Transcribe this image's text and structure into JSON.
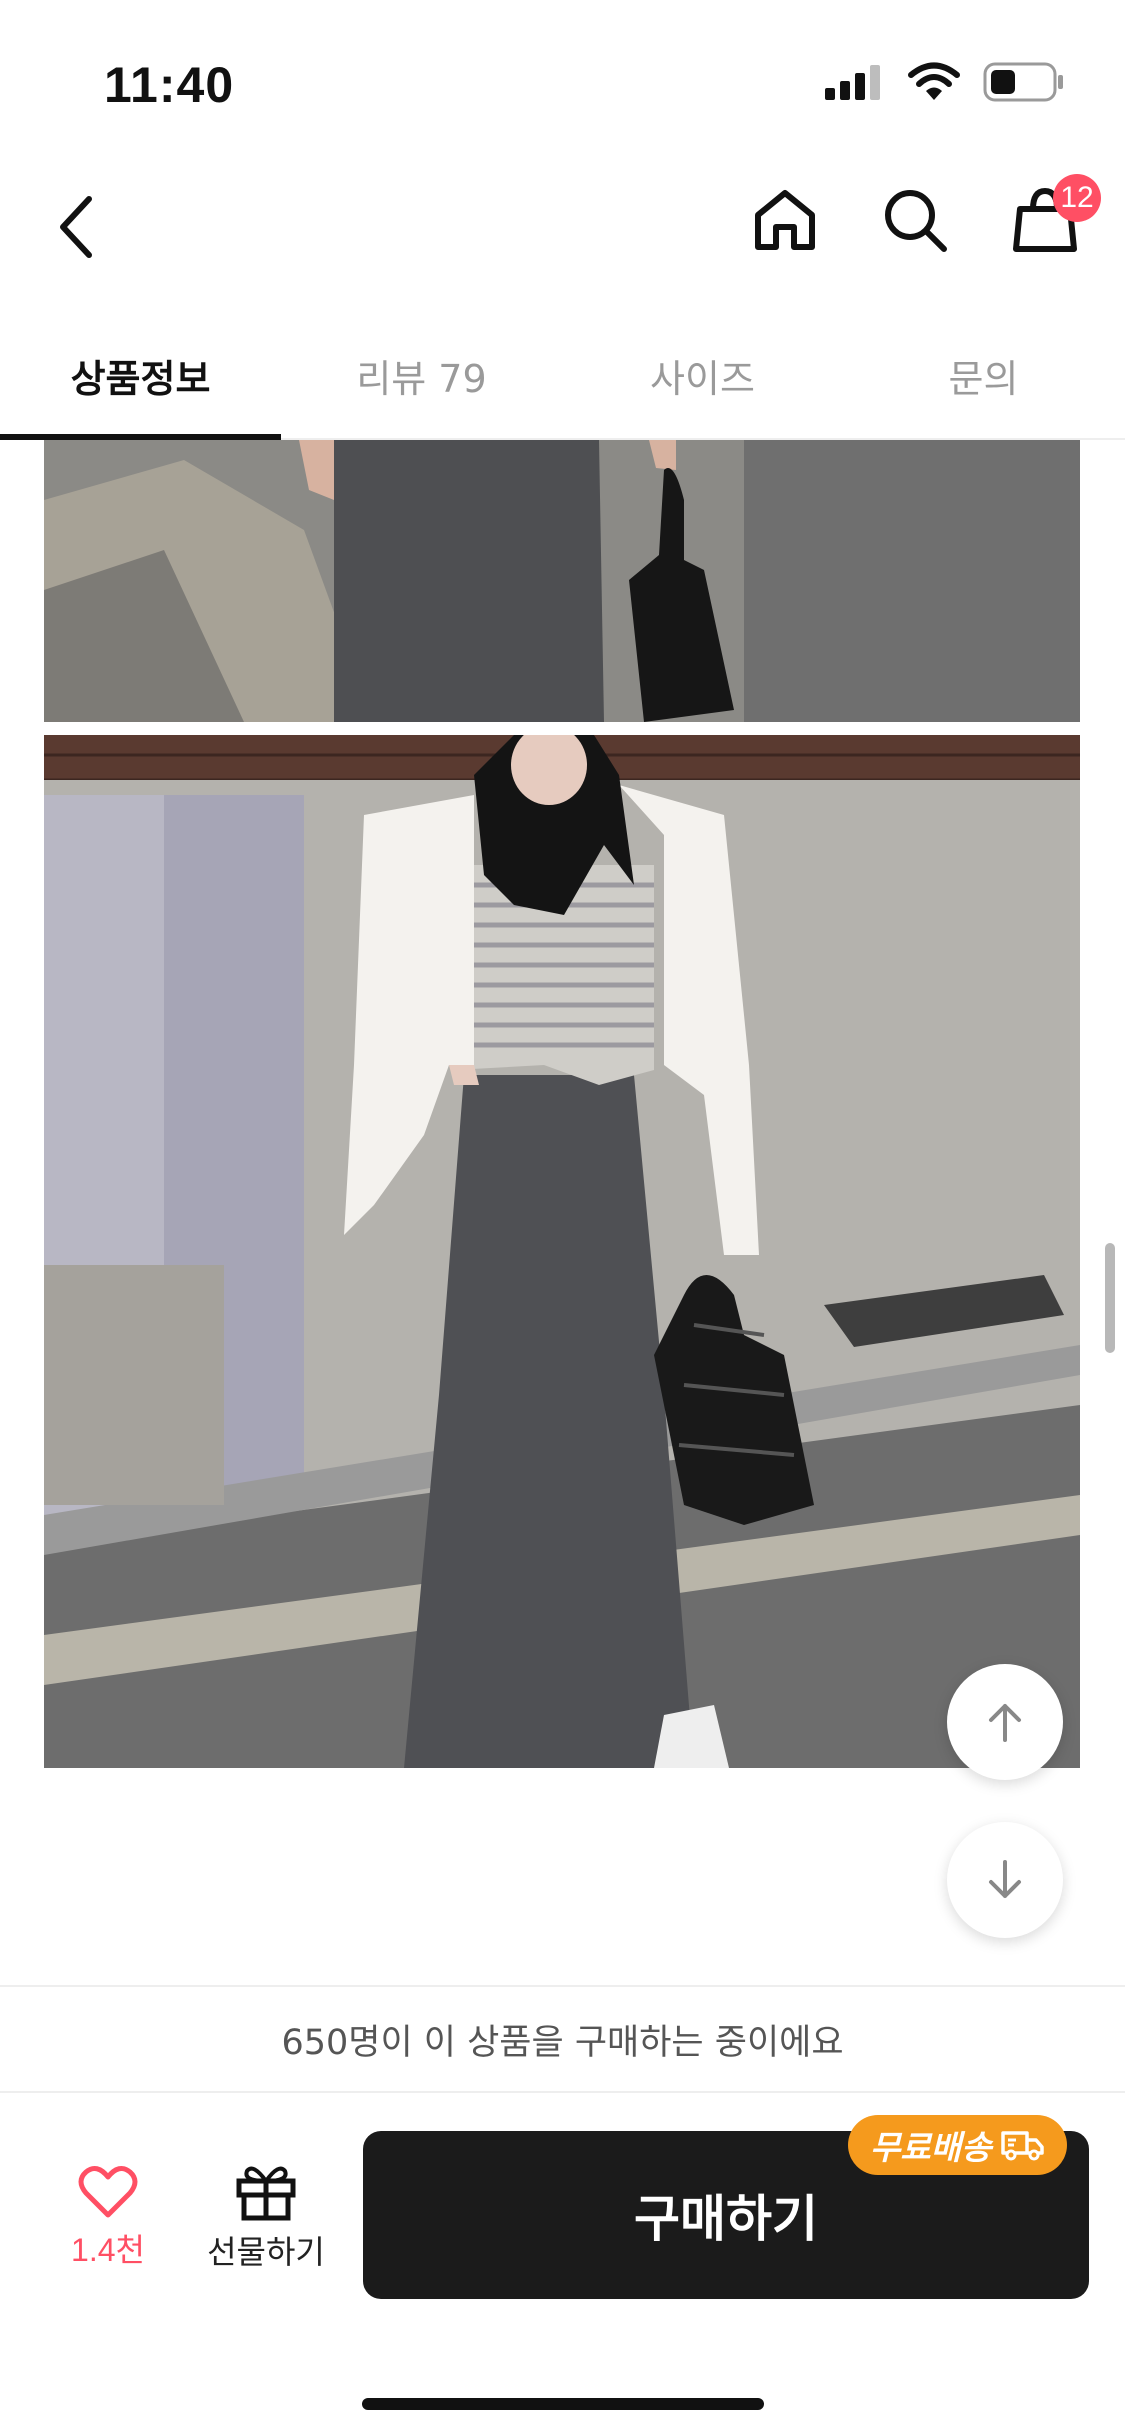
{
  "status_bar": {
    "time": "11:40"
  },
  "cart": {
    "badge_count": "12"
  },
  "tabs": [
    {
      "label": "상품정보",
      "active": true
    },
    {
      "label": "리뷰 79",
      "active": false
    },
    {
      "label": "사이즈",
      "active": false
    },
    {
      "label": "문의",
      "active": false
    }
  ],
  "banner": {
    "text": "650명이 이 상품을 구매하는 중이에요"
  },
  "actions": {
    "like_count": "1.4천",
    "gift_label": "선물하기",
    "buy_label": "구매하기",
    "free_shipping": "무료배송"
  },
  "colors": {
    "accent": "#ff4f64",
    "buy_button": "#1b1b1b",
    "shipping_badge": "#f59a1d"
  }
}
